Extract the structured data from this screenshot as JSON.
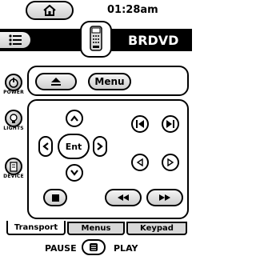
{
  "header": {
    "time": "01:28am",
    "device_name": "BRDVD",
    "home_icon": "home-icon",
    "menu_icon": "list-menu-icon",
    "remote_icon": "remote-icon"
  },
  "side_buttons": [
    {
      "label": "POWER",
      "icon": "power-icon"
    },
    {
      "label": "LIGHTS",
      "icon": "lights-icon"
    },
    {
      "label": "DEVICE",
      "icon": "device-icon"
    }
  ],
  "top_panel": {
    "eject_icon": "eject-icon",
    "menu_label": "Menu"
  },
  "dpad": {
    "enter_label": "Ent",
    "up_icon": "up-arrow-icon",
    "down_icon": "down-arrow-icon",
    "left_icon": "left-arrow-icon",
    "right_icon": "right-arrow-icon"
  },
  "transport_icons": [
    "prev-chapter-icon",
    "next-chapter-icon",
    "step-back-icon",
    "step-forward-icon",
    "stop-icon",
    "rewind-icon",
    "fast-forward-icon"
  ],
  "tabs": [
    {
      "label": "Transport",
      "active": true
    },
    {
      "label": "Menus",
      "active": false
    },
    {
      "label": "Keypad",
      "active": false
    }
  ],
  "footer": {
    "left_label": "PAUSE",
    "right_label": "PLAY",
    "center_icon": "page-icon"
  }
}
